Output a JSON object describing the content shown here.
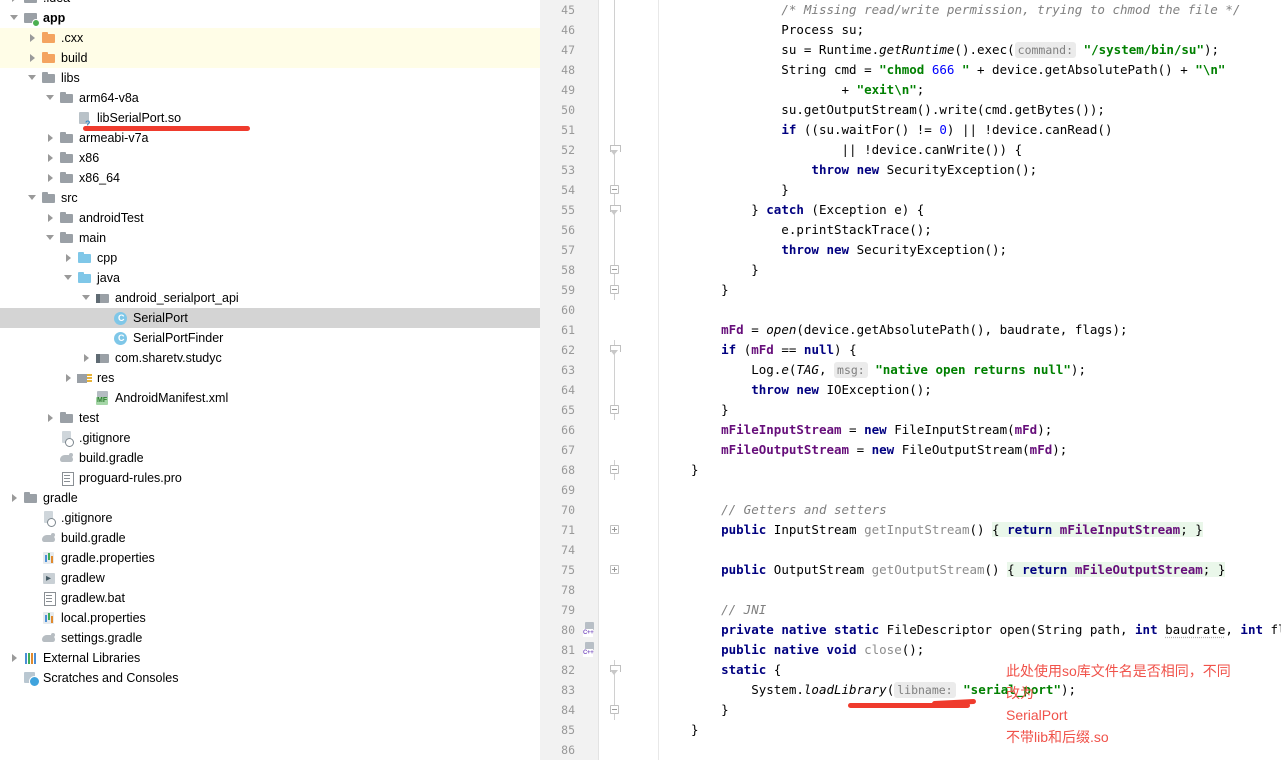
{
  "sidebar": {
    "name": "project-tree",
    "items": [
      {
        "label": ".idea",
        "indent": 8,
        "twisty": "collapsed",
        "icon": "folder-icon",
        "partial": true,
        "bold": false,
        "highlight": "none"
      },
      {
        "label": "app",
        "indent": 8,
        "twisty": "expanded",
        "icon": "module-folder-icon",
        "partial": false,
        "bold": true,
        "highlight": "none"
      },
      {
        "label": ".cxx",
        "indent": 26,
        "twisty": "collapsed",
        "icon": "folder-orange-icon",
        "partial": false,
        "bold": false,
        "highlight": "yellow"
      },
      {
        "label": "build",
        "indent": 26,
        "twisty": "collapsed",
        "icon": "folder-orange-icon",
        "partial": false,
        "bold": false,
        "highlight": "yellow"
      },
      {
        "label": "libs",
        "indent": 26,
        "twisty": "expanded",
        "icon": "folder-icon",
        "partial": false,
        "bold": false,
        "highlight": "none"
      },
      {
        "label": "arm64-v8a",
        "indent": 44,
        "twisty": "expanded",
        "icon": "folder-icon",
        "partial": false,
        "bold": false,
        "highlight": "none"
      },
      {
        "label": "libSerialPort.so",
        "indent": 62,
        "twisty": "none",
        "icon": "so-file-icon",
        "partial": false,
        "bold": false,
        "highlight": "none"
      },
      {
        "label": "armeabi-v7a",
        "indent": 44,
        "twisty": "collapsed",
        "icon": "folder-icon",
        "partial": false,
        "bold": false,
        "highlight": "none"
      },
      {
        "label": "x86",
        "indent": 44,
        "twisty": "collapsed",
        "icon": "folder-icon",
        "partial": false,
        "bold": false,
        "highlight": "none"
      },
      {
        "label": "x86_64",
        "indent": 44,
        "twisty": "collapsed",
        "icon": "folder-icon",
        "partial": false,
        "bold": false,
        "highlight": "none"
      },
      {
        "label": "src",
        "indent": 26,
        "twisty": "expanded",
        "icon": "folder-icon",
        "partial": false,
        "bold": false,
        "highlight": "none"
      },
      {
        "label": "androidTest",
        "indent": 44,
        "twisty": "collapsed",
        "icon": "folder-icon",
        "partial": false,
        "bold": false,
        "highlight": "none"
      },
      {
        "label": "main",
        "indent": 44,
        "twisty": "expanded",
        "icon": "folder-icon",
        "partial": false,
        "bold": false,
        "highlight": "none"
      },
      {
        "label": "cpp",
        "indent": 62,
        "twisty": "collapsed",
        "icon": "cpp-folder-icon",
        "partial": false,
        "bold": false,
        "highlight": "none"
      },
      {
        "label": "java",
        "indent": 62,
        "twisty": "expanded",
        "icon": "folder-blue-icon",
        "partial": false,
        "bold": false,
        "highlight": "none"
      },
      {
        "label": "android_serialport_api",
        "indent": 80,
        "twisty": "expanded",
        "icon": "package-icon",
        "partial": false,
        "bold": false,
        "highlight": "none"
      },
      {
        "label": "SerialPort",
        "indent": 98,
        "twisty": "none",
        "icon": "java-class-icon",
        "partial": false,
        "bold": false,
        "highlight": "selected"
      },
      {
        "label": "SerialPortFinder",
        "indent": 98,
        "twisty": "none",
        "icon": "java-class-icon",
        "partial": false,
        "bold": false,
        "highlight": "none"
      },
      {
        "label": "com.sharetv.studyc",
        "indent": 80,
        "twisty": "collapsed",
        "icon": "package-icon",
        "partial": false,
        "bold": false,
        "highlight": "none"
      },
      {
        "label": "res",
        "indent": 62,
        "twisty": "collapsed",
        "icon": "res-folder-icon",
        "partial": false,
        "bold": false,
        "highlight": "none"
      },
      {
        "label": "AndroidManifest.xml",
        "indent": 80,
        "twisty": "none",
        "icon": "manifest-icon",
        "partial": false,
        "bold": false,
        "highlight": "none"
      },
      {
        "label": "test",
        "indent": 44,
        "twisty": "collapsed",
        "icon": "folder-icon",
        "partial": false,
        "bold": false,
        "highlight": "none"
      },
      {
        "label": ".gitignore",
        "indent": 44,
        "twisty": "none",
        "icon": "gitignore-icon",
        "partial": false,
        "bold": false,
        "highlight": "none"
      },
      {
        "label": "build.gradle",
        "indent": 44,
        "twisty": "none",
        "icon": "gradle-icon",
        "partial": false,
        "bold": false,
        "highlight": "none"
      },
      {
        "label": "proguard-rules.pro",
        "indent": 44,
        "twisty": "none",
        "icon": "file-icon",
        "partial": false,
        "bold": false,
        "highlight": "none"
      },
      {
        "label": "gradle",
        "indent": 8,
        "twisty": "collapsed",
        "icon": "folder-icon",
        "partial": false,
        "bold": false,
        "highlight": "none"
      },
      {
        "label": ".gitignore",
        "indent": 26,
        "twisty": "none",
        "icon": "gitignore-icon",
        "partial": false,
        "bold": false,
        "highlight": "none"
      },
      {
        "label": "build.gradle",
        "indent": 26,
        "twisty": "none",
        "icon": "gradle-icon",
        "partial": false,
        "bold": false,
        "highlight": "none"
      },
      {
        "label": "gradle.properties",
        "indent": 26,
        "twisty": "none",
        "icon": "properties-icon",
        "partial": false,
        "bold": false,
        "highlight": "none"
      },
      {
        "label": "gradlew",
        "indent": 26,
        "twisty": "none",
        "icon": "script-icon",
        "partial": false,
        "bold": false,
        "highlight": "none"
      },
      {
        "label": "gradlew.bat",
        "indent": 26,
        "twisty": "none",
        "icon": "file-icon",
        "partial": false,
        "bold": false,
        "highlight": "none"
      },
      {
        "label": "local.properties",
        "indent": 26,
        "twisty": "none",
        "icon": "properties-icon",
        "partial": false,
        "bold": false,
        "highlight": "none"
      },
      {
        "label": "settings.gradle",
        "indent": 26,
        "twisty": "none",
        "icon": "gradle-icon",
        "partial": false,
        "bold": false,
        "highlight": "none"
      },
      {
        "label": "External Libraries",
        "indent": 8,
        "twisty": "collapsed",
        "icon": "external-libraries-icon",
        "partial": false,
        "bold": false,
        "highlight": "none"
      },
      {
        "label": "Scratches and Consoles",
        "indent": 8,
        "twisty": "none",
        "icon": "scratches-icon",
        "partial": false,
        "bold": false,
        "highlight": "none"
      }
    ]
  },
  "editor": {
    "name": "code-editor",
    "language": "java",
    "first_visible_line": 45,
    "lines": [
      {
        "num": "45",
        "fold": "line",
        "gicon": "none",
        "html": "            <span class=\"cmt\">/* Missing read/write permission, trying to chmod the file */</span>"
      },
      {
        "num": "46",
        "fold": "line",
        "gicon": "none",
        "html": "            Process su;"
      },
      {
        "num": "47",
        "fold": "line",
        "gicon": "none",
        "html": "            su = Runtime.<span class=\"stc\">getRuntime</span>().exec(<span class=\"hint\">command:</span> <span class=\"str\">\"/system/bin/su\"</span>);"
      },
      {
        "num": "48",
        "fold": "line",
        "gicon": "none",
        "html": "            String cmd = <span class=\"str\">\"chmod </span><span class=\"num\">666</span><span class=\"str\"> \"</span> + device.getAbsolutePath() + <span class=\"str\">\"\\n\"</span>"
      },
      {
        "num": "49",
        "fold": "line",
        "gicon": "none",
        "html": "                    + <span class=\"str\">\"exit\\n\"</span>;"
      },
      {
        "num": "50",
        "fold": "line",
        "gicon": "none",
        "html": "            su.getOutputStream().write(cmd.getBytes());"
      },
      {
        "num": "51",
        "fold": "line",
        "gicon": "none",
        "html": "            <span class=\"kw\">if</span> ((su.waitFor() != <span class=\"num\">0</span>) || !device.canRead()"
      },
      {
        "num": "52",
        "fold": "arrow",
        "gicon": "none",
        "html": "                    || !device.canWrite()) {"
      },
      {
        "num": "53",
        "fold": "line",
        "gicon": "none",
        "html": "                <span class=\"kw\">throw new</span> SecurityException();"
      },
      {
        "num": "54",
        "fold": "box",
        "gicon": "none",
        "html": "            }"
      },
      {
        "num": "55",
        "fold": "arrow",
        "gicon": "none",
        "html": "        } <span class=\"kw\">catch</span> (Exception e) {"
      },
      {
        "num": "56",
        "fold": "line",
        "gicon": "none",
        "html": "            e.printStackTrace();"
      },
      {
        "num": "57",
        "fold": "line",
        "gicon": "none",
        "html": "            <span class=\"kw\">throw new</span> SecurityException();"
      },
      {
        "num": "58",
        "fold": "box",
        "gicon": "none",
        "html": "        }"
      },
      {
        "num": "59",
        "fold": "box",
        "gicon": "none",
        "html": "    }"
      },
      {
        "num": "60",
        "fold": "none",
        "gicon": "none",
        "html": ""
      },
      {
        "num": "61",
        "fold": "none",
        "gicon": "none",
        "html": "    <span class=\"fld\">mFd</span> = <span class=\"stc\">open</span>(device.getAbsolutePath(), baudrate, flags);"
      },
      {
        "num": "62",
        "fold": "arrow",
        "gicon": "none",
        "html": "    <span class=\"kw\">if</span> (<span class=\"fld\">mFd</span> == <span class=\"kw\">null</span>) {"
      },
      {
        "num": "63",
        "fold": "line",
        "gicon": "none",
        "html": "        Log.<span class=\"stc\">e</span>(<span class=\"mth\">TAG</span>, <span class=\"hint\">msg:</span> <span class=\"str\">\"native open returns null\"</span>);"
      },
      {
        "num": "64",
        "fold": "line",
        "gicon": "none",
        "html": "        <span class=\"kw\">throw new</span> IOException();"
      },
      {
        "num": "65",
        "fold": "box",
        "gicon": "none",
        "html": "    }"
      },
      {
        "num": "66",
        "fold": "none",
        "gicon": "none",
        "html": "    <span class=\"fld\">mFileInputStream</span> = <span class=\"kw\">new</span> FileInputStream(<span class=\"fld\">mFd</span>);"
      },
      {
        "num": "67",
        "fold": "none",
        "gicon": "none",
        "html": "    <span class=\"fld\">mFileOutputStream</span> = <span class=\"kw\">new</span> FileOutputStream(<span class=\"fld\">mFd</span>);"
      },
      {
        "num": "68",
        "fold": "box",
        "gicon": "none",
        "html": "}"
      },
      {
        "num": "69",
        "fold": "none",
        "gicon": "none",
        "html": ""
      },
      {
        "num": "70",
        "fold": "none",
        "gicon": "none",
        "html": "    <span class=\"cmt\">// Getters and setters</span>"
      },
      {
        "num": "71",
        "fold": "plus",
        "gicon": "none",
        "html": "    <span class=\"kw\">public</span> InputStream <span class=\"gry\">getInputStream</span>() <span class=\"folded\">{ <span class=\"kw\">return</span> <span class=\"fld\">mFileInputStream</span>; }</span>"
      },
      {
        "num": "74",
        "fold": "none",
        "gicon": "none",
        "html": ""
      },
      {
        "num": "75",
        "fold": "plus",
        "gicon": "none",
        "html": "    <span class=\"kw\">public</span> OutputStream <span class=\"gry\">getOutputStream</span>() <span class=\"folded\">{ <span class=\"kw\">return</span> <span class=\"fld\">mFileOutputStream</span>; }</span>"
      },
      {
        "num": "78",
        "fold": "none",
        "gicon": "none",
        "html": ""
      },
      {
        "num": "79",
        "fold": "none",
        "gicon": "none",
        "html": "    <span class=\"cmt\">// JNI</span>"
      },
      {
        "num": "80",
        "fold": "none",
        "gicon": "cpp",
        "html": "    <span class=\"kw\">private native static</span> FileDescriptor open(String path, <span class=\"kw\">int</span> <span class=\"wavy\">baudrate</span>, <span class=\"kw\">int</span> flags);"
      },
      {
        "num": "81",
        "fold": "none",
        "gicon": "cpp",
        "html": "    <span class=\"kw\">public native void</span> <span class=\"gry\">close</span>();"
      },
      {
        "num": "82",
        "fold": "arrow",
        "gicon": "none",
        "html": "    <span class=\"kw\">static</span> {"
      },
      {
        "num": "83",
        "fold": "line",
        "gicon": "none",
        "html": "        System.<span class=\"stc\">loadLibrary</span>(<span class=\"hint\">libname:</span> <span class=\"str\">\"serial_port\"</span>);"
      },
      {
        "num": "84",
        "fold": "box",
        "gicon": "none",
        "html": "    }"
      },
      {
        "num": "85",
        "fold": "none",
        "gicon": "none",
        "html": "}"
      },
      {
        "num": "86",
        "fold": "none",
        "gicon": "none",
        "html": ""
      }
    ]
  },
  "annotation": {
    "name": "red-handwritten-note",
    "color": "#f0524a",
    "lines": [
      "此处使用so库文件名是否相同，不同",
      "改为",
      "SerialPort",
      "不带lib和后缀.so"
    ]
  },
  "markup": {
    "sidebar_underline_target": "libSerialPort.so",
    "editor_underline_target": "\"serial_port\"",
    "stroke_color": "#ef3b2d"
  }
}
